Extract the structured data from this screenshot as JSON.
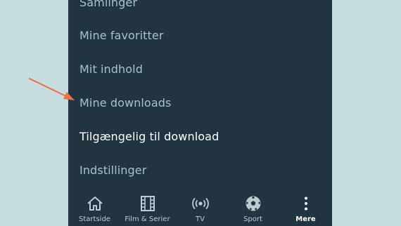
{
  "menu": {
    "items": [
      {
        "label": "Samlinger",
        "active": false
      },
      {
        "label": "Mine favoritter",
        "active": false
      },
      {
        "label": "Mit indhold",
        "active": false
      },
      {
        "label": "Mine downloads",
        "active": false
      },
      {
        "label": "Tilgængelig til download",
        "active": true
      },
      {
        "label": "Indstillinger",
        "active": false
      }
    ]
  },
  "bottom_nav": {
    "items": [
      {
        "label": "Startside",
        "icon": "home-icon"
      },
      {
        "label": "Film & Serier",
        "icon": "film-icon"
      },
      {
        "label": "TV",
        "icon": "broadcast-icon"
      },
      {
        "label": "Sport",
        "icon": "soccer-ball-icon"
      },
      {
        "label": "Mere",
        "icon": "more-vertical-icon",
        "active": true
      }
    ]
  },
  "colors": {
    "panel": "#213440",
    "background": "#c7dcdf",
    "menu_text": "#a9c2c5",
    "active_text": "#ffffff",
    "annotation_arrow": "#e8734a"
  }
}
